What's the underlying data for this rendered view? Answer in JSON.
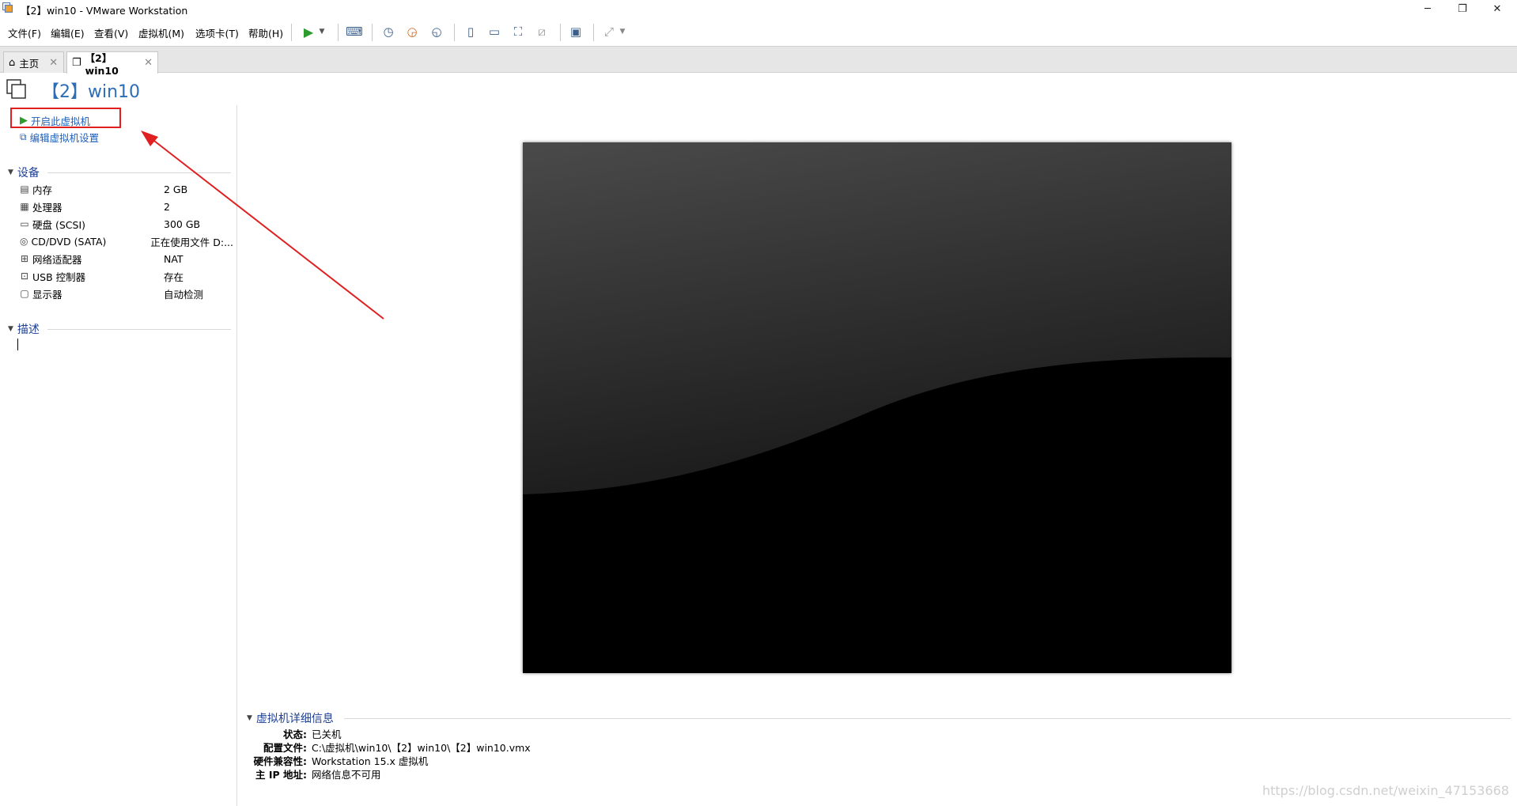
{
  "window": {
    "title": "【2】win10 - VMware Workstation",
    "controls": {
      "minimize": "─",
      "restore": "❐",
      "close": "✕"
    }
  },
  "menu": {
    "items": [
      "文件(F)",
      "编辑(E)",
      "查看(V)",
      "虚拟机(M)",
      "选项卡(T)",
      "帮助(H)"
    ]
  },
  "tabs": [
    {
      "label": "主页",
      "icon": "home-icon",
      "active": false
    },
    {
      "label": "【2】win10",
      "icon": "vm-icon",
      "active": true
    }
  ],
  "vm": {
    "name": "【2】win10",
    "actions": {
      "power_on": "开启此虚拟机",
      "edit_settings": "编辑虚拟机设置"
    }
  },
  "devices": {
    "heading": "设备",
    "rows": [
      {
        "icon": "memory-icon",
        "name": "内存",
        "value": "2 GB"
      },
      {
        "icon": "cpu-icon",
        "name": "处理器",
        "value": "2"
      },
      {
        "icon": "harddisk-icon",
        "name": "硬盘 (SCSI)",
        "value": "300 GB"
      },
      {
        "icon": "cd-icon",
        "name": "CD/DVD (SATA)",
        "value": "正在使用文件 D:..."
      },
      {
        "icon": "network-icon",
        "name": "网络适配器",
        "value": "NAT"
      },
      {
        "icon": "usb-icon",
        "name": "USB 控制器",
        "value": "存在"
      },
      {
        "icon": "display-icon",
        "name": "显示器",
        "value": "自动检测"
      }
    ]
  },
  "description": {
    "heading": "描述"
  },
  "details": {
    "heading": "虚拟机详细信息",
    "rows": [
      {
        "label": "状态:",
        "value": "已关机"
      },
      {
        "label": "配置文件:",
        "value": "C:\\虚拟机\\win10\\【2】win10\\【2】win10.vmx"
      },
      {
        "label": "硬件兼容性:",
        "value": "Workstation 15.x 虚拟机"
      },
      {
        "label": "主 IP 地址:",
        "value": "网络信息不可用"
      }
    ]
  },
  "watermark": "https://blog.csdn.net/weixin_47153668",
  "colors": {
    "accent": "#2c6db4",
    "highlight": "#e02020",
    "play": "#2e9b2e"
  }
}
